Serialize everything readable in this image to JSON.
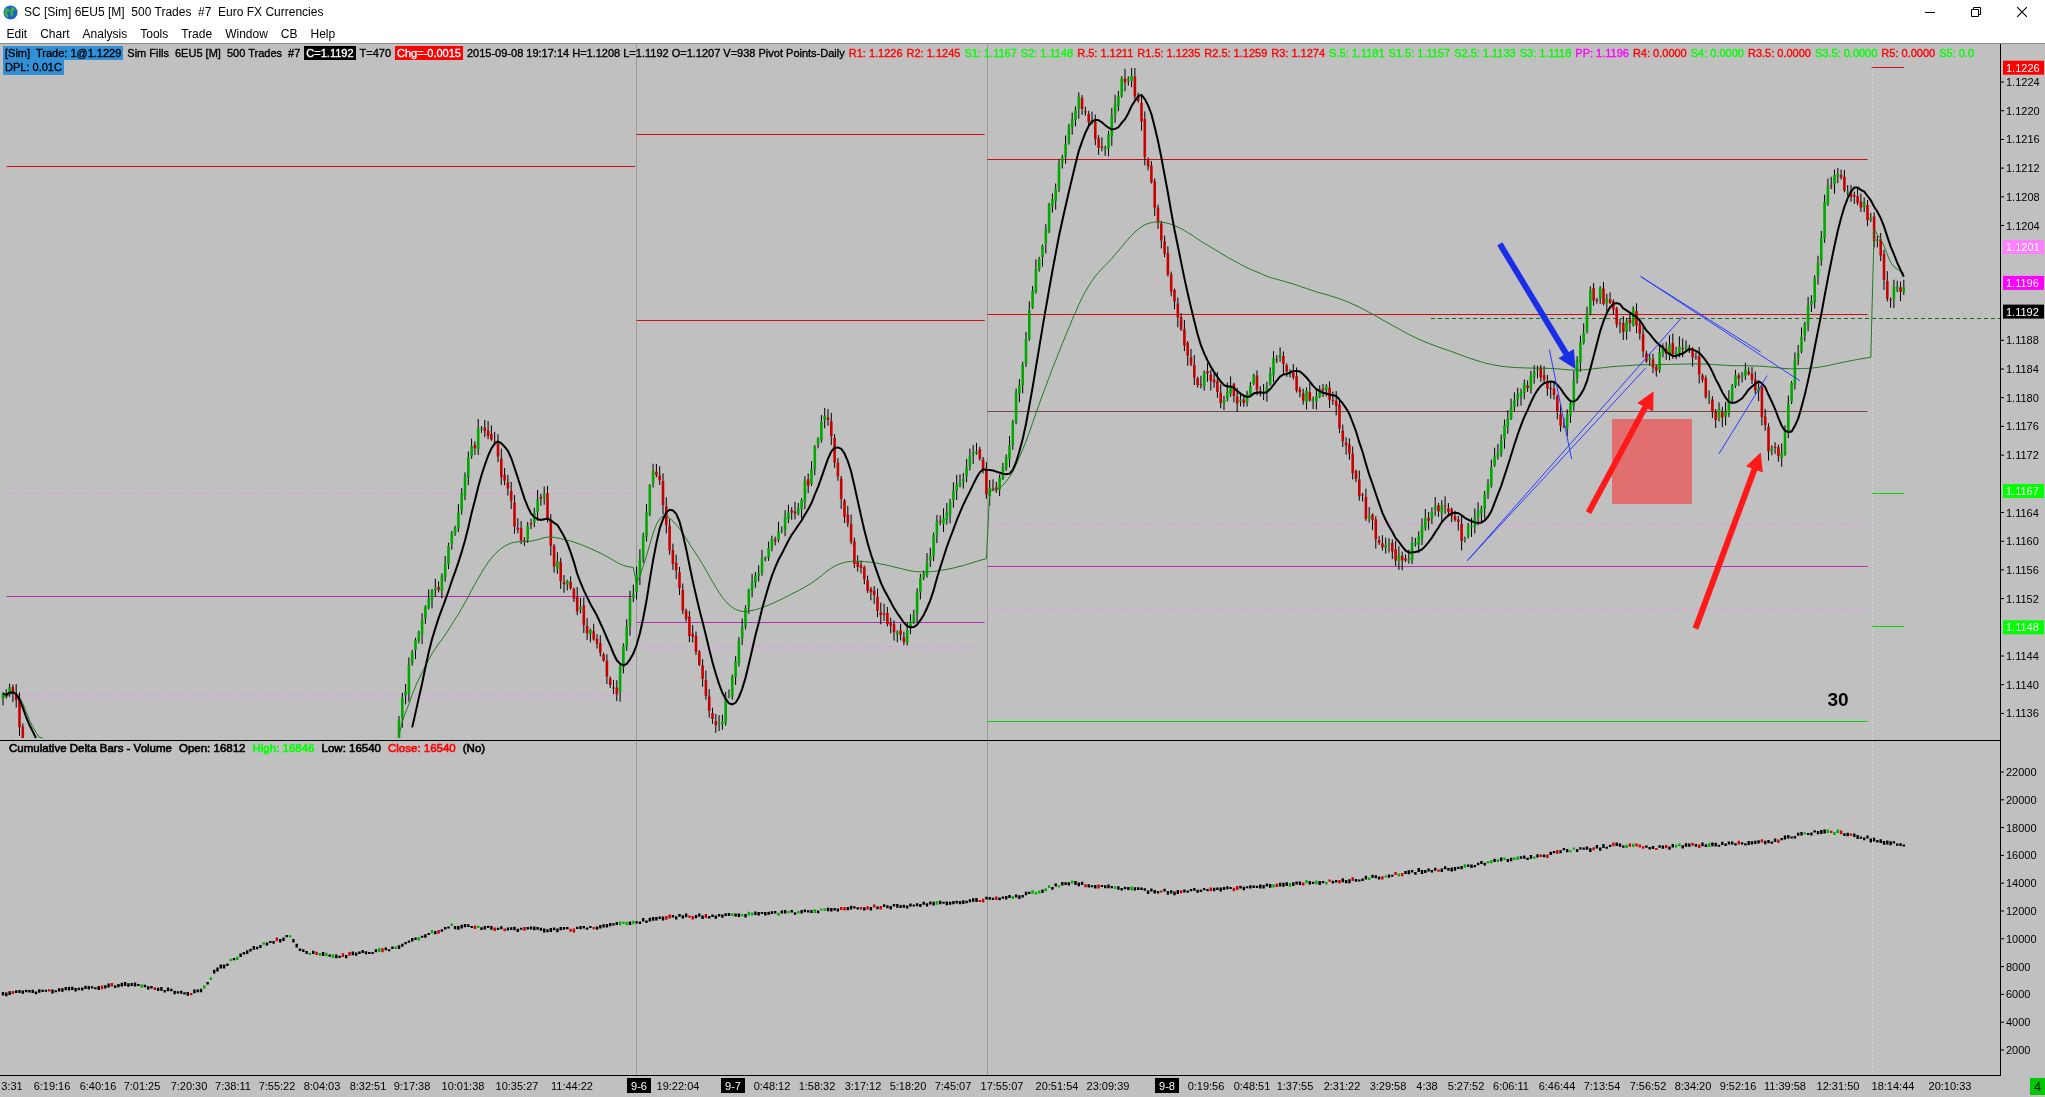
{
  "window": {
    "title": "SC [Sim] 6EU5 [M]  500 Trades  #7  Euro FX Currencies"
  },
  "menu": [
    "Edit",
    "Chart",
    "Analysis",
    "Tools",
    "Trade",
    "Window",
    "CB",
    "Help"
  ],
  "price_panel": {
    "info_lines": [
      [
        {
          "kind": "tag",
          "text": "[Sim]  Trade: 1@1.1229",
          "color": "#3090d8"
        },
        {
          "kind": "text",
          "text": "Sim Fills  6EU5 [M]  500 Trades  #7",
          "color": "#000000"
        },
        {
          "kind": "tag",
          "text": "C=1.1192",
          "color": "#000000"
        },
        {
          "kind": "text",
          "text": "T=470",
          "color": "#000000"
        },
        {
          "kind": "tag",
          "text": "Chg=-0.0015",
          "color": "#ff0000"
        },
        {
          "kind": "text",
          "text": "2015-09-08 19:17:14 H=1.1208 L=1.1192 O=1.1207 V=938 Pivot Points-Daily",
          "color": "#000000"
        },
        {
          "kind": "text",
          "text": "R1: 1.1226",
          "color": "#ff0000"
        },
        {
          "kind": "text",
          "text": "R2: 1.1245",
          "color": "#ff0000"
        },
        {
          "kind": "text",
          "text": "S1: 1.1167",
          "color": "#00ff00"
        },
        {
          "kind": "text",
          "text": "S2: 1.1148",
          "color": "#00ff00"
        },
        {
          "kind": "text",
          "text": "R.5: 1.1211",
          "color": "#ff0000"
        },
        {
          "kind": "text",
          "text": "R1.5: 1.1235",
          "color": "#ff0000"
        },
        {
          "kind": "text",
          "text": "R2.5: 1.1259",
          "color": "#ff0000"
        },
        {
          "kind": "text",
          "text": "R3: 1.1274",
          "color": "#ff0000"
        },
        {
          "kind": "text",
          "text": "S.5: 1.1181",
          "color": "#00ff00"
        },
        {
          "kind": "text",
          "text": "S1.5: 1.1157",
          "color": "#00ff00"
        },
        {
          "kind": "text",
          "text": "S2.5: 1.1133",
          "color": "#00ff00"
        },
        {
          "kind": "text",
          "text": "S3: 1.1118",
          "color": "#00ff00"
        },
        {
          "kind": "text",
          "text": "PP: 1.1196",
          "color": "#ff00ff"
        },
        {
          "kind": "text",
          "text": "R4: 0.0000",
          "color": "#ff0000"
        },
        {
          "kind": "text",
          "text": "S4: 0.0000",
          "color": "#00ff00"
        },
        {
          "kind": "text",
          "text": "R3.5: 0.0000",
          "color": "#ff0000"
        },
        {
          "kind": "text",
          "text": "S3.5: 0.0000",
          "color": "#00ff00"
        },
        {
          "kind": "text",
          "text": "R5: 0.0000",
          "color": "#ff0000"
        },
        {
          "kind": "text",
          "text": "S5: 0.0",
          "color": "#00ff00"
        }
      ],
      [
        {
          "kind": "tag",
          "text": "DPL: 0.01C",
          "color": "#3090d8"
        }
      ]
    ],
    "bar_counter": "30",
    "price_ticks": [
      "1.1224",
      "1.1220",
      "1.1216",
      "1.1212",
      "1.1208",
      "1.1204",
      "1.1188",
      "1.1184",
      "1.1180",
      "1.1176",
      "1.1172",
      "1.1164",
      "1.1160",
      "1.1156",
      "1.1152",
      "1.1144",
      "1.1140",
      "1.1136"
    ],
    "price_markers": [
      {
        "text": "1.1226",
        "color": "#ff0000"
      },
      {
        "text": "1.1201",
        "color": "#ff80ff"
      },
      {
        "text": "1.1196",
        "color": "#ff00ff"
      },
      {
        "text": "1.1192",
        "color": "#000000"
      },
      {
        "text": "1.1167",
        "color": "#00ff00"
      },
      {
        "text": "1.1148",
        "color": "#00ff00"
      }
    ]
  },
  "study_panel": {
    "header": [
      {
        "text": "Cumulative Delta Bars - Volume",
        "color": "#000000"
      },
      {
        "text": "Open: 16812",
        "color": "#000000"
      },
      {
        "text": "High: 16846",
        "color": "#00ff00"
      },
      {
        "text": "Low: 16540",
        "color": "#000000"
      },
      {
        "text": "Close: 16540",
        "color": "#ff0000"
      },
      {
        "text": "(No)",
        "color": "#000000"
      }
    ],
    "value_ticks": [
      "22000",
      "20000",
      "18000",
      "16000",
      "14000",
      "12000",
      "10000",
      "8000",
      "6000",
      "4000",
      "2000"
    ]
  },
  "time_axis": [
    {
      "kind": "time",
      "text": "3:31"
    },
    {
      "kind": "time",
      "text": "6:19:16"
    },
    {
      "kind": "time",
      "text": "6:40:16"
    },
    {
      "kind": "time",
      "text": "7:01:25"
    },
    {
      "kind": "time",
      "text": "7:20:30"
    },
    {
      "kind": "time",
      "text": "7:38:11"
    },
    {
      "kind": "time",
      "text": "7:55:22"
    },
    {
      "kind": "time",
      "text": "8:04:03"
    },
    {
      "kind": "time",
      "text": "8:32:51"
    },
    {
      "kind": "time",
      "text": "9:17:38"
    },
    {
      "kind": "time",
      "text": "10:01:38"
    },
    {
      "kind": "time",
      "text": "10:35:27"
    },
    {
      "kind": "time",
      "text": "11:44:22"
    },
    {
      "kind": "date",
      "text": "9-6"
    },
    {
      "kind": "time",
      "text": "19:22:04"
    },
    {
      "kind": "date",
      "text": "9-7"
    },
    {
      "kind": "time",
      "text": "0:48:12"
    },
    {
      "kind": "time",
      "text": "1:58:32"
    },
    {
      "kind": "time",
      "text": "3:17:12"
    },
    {
      "kind": "time",
      "text": "5:18:20"
    },
    {
      "kind": "time",
      "text": "7:45:07"
    },
    {
      "kind": "time",
      "text": "17:55:07"
    },
    {
      "kind": "time",
      "text": "20:51:54"
    },
    {
      "kind": "time",
      "text": "23:09:39"
    },
    {
      "kind": "date",
      "text": "9-8"
    },
    {
      "kind": "time",
      "text": "0:19:56"
    },
    {
      "kind": "time",
      "text": "0:48:51"
    },
    {
      "kind": "time",
      "text": "1:37:55"
    },
    {
      "kind": "time",
      "text": "2:31:22"
    },
    {
      "kind": "time",
      "text": "3:29:58"
    },
    {
      "kind": "time",
      "text": "4:38"
    },
    {
      "kind": "time",
      "text": "5:27:52"
    },
    {
      "kind": "time",
      "text": "6:06:11"
    },
    {
      "kind": "time",
      "text": "6:46:44"
    },
    {
      "kind": "time",
      "text": "7:13:54"
    },
    {
      "kind": "time",
      "text": "7:56:52"
    },
    {
      "kind": "time",
      "text": "8:34:20"
    },
    {
      "kind": "time",
      "text": "9:52:16"
    },
    {
      "kind": "time",
      "text": "11:39:58"
    },
    {
      "kind": "time",
      "text": "12:31:50"
    },
    {
      "kind": "time",
      "text": "18:14:44"
    },
    {
      "kind": "time",
      "text": "20:10:33"
    }
  ],
  "corner_badge": "4"
}
